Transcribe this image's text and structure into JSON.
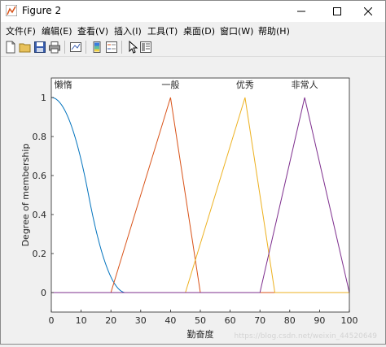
{
  "window": {
    "title": "Figure 2"
  },
  "menu": [
    {
      "label": "文件(F)"
    },
    {
      "label": "编辑(E)"
    },
    {
      "label": "查看(V)"
    },
    {
      "label": "插入(I)"
    },
    {
      "label": "工具(T)"
    },
    {
      "label": "桌面(D)"
    },
    {
      "label": "窗口(W)"
    },
    {
      "label": "帮助(H)"
    }
  ],
  "toolbar": {
    "icons": [
      "new-figure-icon",
      "open-file-icon",
      "save-icon",
      "print-icon",
      "link-plot-icon",
      "insert-colorbar-icon",
      "insert-legend-icon",
      "edit-plot-arrow-icon",
      "property-inspector-icon"
    ]
  },
  "chart_data": {
    "type": "line",
    "title": "",
    "xlabel": "勤奋度",
    "ylabel": "Degree of membership",
    "xlim": [
      0,
      100
    ],
    "ylim": [
      -0.1,
      1.1
    ],
    "xticks": [
      0,
      10,
      20,
      30,
      40,
      50,
      60,
      70,
      80,
      90,
      100
    ],
    "yticks": [
      0,
      0.2,
      0.4,
      0.6,
      0.8,
      1
    ],
    "ytick_labels": [
      "0",
      "0.2",
      "0.4",
      "0.6",
      "0.8",
      "1"
    ],
    "grid": false,
    "series": [
      {
        "name": "懒惰",
        "shape": "zmf",
        "params": [
          0,
          25
        ],
        "color": "#0072bd",
        "label_x": 4
      },
      {
        "name": "一般",
        "shape": "trimf",
        "params": [
          20,
          40,
          50
        ],
        "color": "#d95319",
        "label_x": 40
      },
      {
        "name": "优秀",
        "shape": "trimf",
        "params": [
          45,
          65,
          75
        ],
        "color": "#edb120",
        "label_x": 65
      },
      {
        "name": "非常人",
        "shape": "trimf",
        "params": [
          70,
          85,
          100
        ],
        "color": "#7e2f8e",
        "label_x": 85
      }
    ]
  },
  "watermark": "https://blog.csdn.net/weixin_44520649"
}
